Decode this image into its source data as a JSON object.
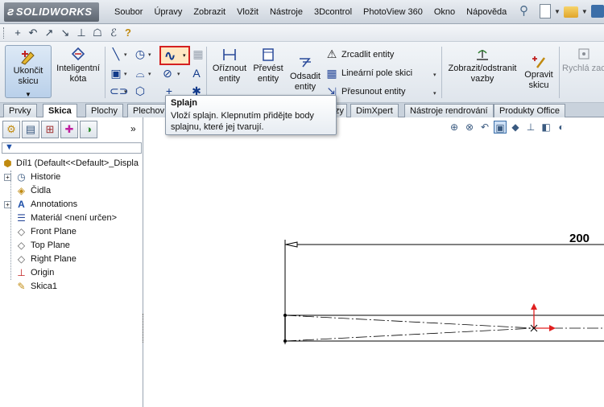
{
  "app": {
    "logo": "SOLIDWORKS"
  },
  "menu": [
    "Soubor",
    "Úpravy",
    "Zobrazit",
    "Vložit",
    "Nástroje",
    "3Dcontrol",
    "PhotoView 360",
    "Okno",
    "Nápověda"
  ],
  "commands": {
    "exit_sketch": "Ukončit skicu",
    "smart_dim": "Inteligentní kóta",
    "trim": "Oříznout entity",
    "convert": "Převést entity",
    "offset": "Odsadit entity",
    "mirror": "Zrcadlit entity",
    "linear_pattern": "Lineární pole skici",
    "move": "Přesunout entity",
    "display_delete": "Zobrazit/odstranit vazby",
    "repair": "Opravit skicu",
    "quick_snaps": "Rychlá zachytávání"
  },
  "tabs": [
    "Prvky",
    "Skica",
    "Plochy",
    "Plechov",
    "zy",
    "DimXpert",
    "Nástroje rendrování",
    "Produkty Office"
  ],
  "active_tab": "Skica",
  "tooltip": {
    "title": "Splajn",
    "body": "Vloží splajn. Klepnutím přidějte body splajnu, které jej tvarují."
  },
  "feature_tree": {
    "root": "Díl1  (Default<<Default>_Displa",
    "items": [
      {
        "label": "Historie",
        "icon": "history-icon",
        "expandable": true
      },
      {
        "label": "Čidla",
        "icon": "sensors-icon",
        "expandable": false
      },
      {
        "label": "Annotations",
        "icon": "annotations-icon",
        "expandable": true
      },
      {
        "label": "Materiál <není určen>",
        "icon": "material-icon",
        "expandable": false
      },
      {
        "label": "Front Plane",
        "icon": "plane-icon",
        "expandable": false
      },
      {
        "label": "Top Plane",
        "icon": "plane-icon",
        "expandable": false
      },
      {
        "label": "Right Plane",
        "icon": "plane-icon",
        "expandable": false
      },
      {
        "label": "Origin",
        "icon": "origin-icon",
        "expandable": false
      },
      {
        "label": "Skica1",
        "icon": "sketch-icon",
        "expandable": false
      }
    ]
  },
  "drawing": {
    "dimension": "200"
  },
  "colors": {
    "accent": "#d42020",
    "sketch": "#000000",
    "origin": "#e02020"
  }
}
